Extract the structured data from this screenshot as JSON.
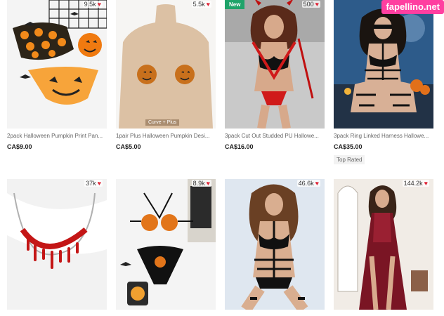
{
  "watermark": "fapellino.net",
  "products": [
    {
      "title": "2pack Halloween Pumpkin Print Pan...",
      "price": "CA$9.00",
      "likes": "9.5k"
    },
    {
      "title": "1pair Plus Halloween Pumpkin Desi...",
      "price": "CA$5.00",
      "likes": "5.5k",
      "image_caption": "Curve + Plus"
    },
    {
      "title": "3pack Cut Out Studded PU Hallowe...",
      "price": "CA$16.00",
      "likes": "500",
      "badge": "New"
    },
    {
      "title": "3pack Ring Linked Harness Hallowe...",
      "price": "CA$35.00",
      "tag": "Top Rated"
    },
    {
      "likes": "37k"
    },
    {
      "likes": "8.9k"
    },
    {
      "likes": "46.6k"
    },
    {
      "likes": "144.2k"
    }
  ],
  "colors": {
    "heart": "#e0283a",
    "new_badge": "#1fa36a",
    "watermark_bg": "#ff3fa0"
  }
}
